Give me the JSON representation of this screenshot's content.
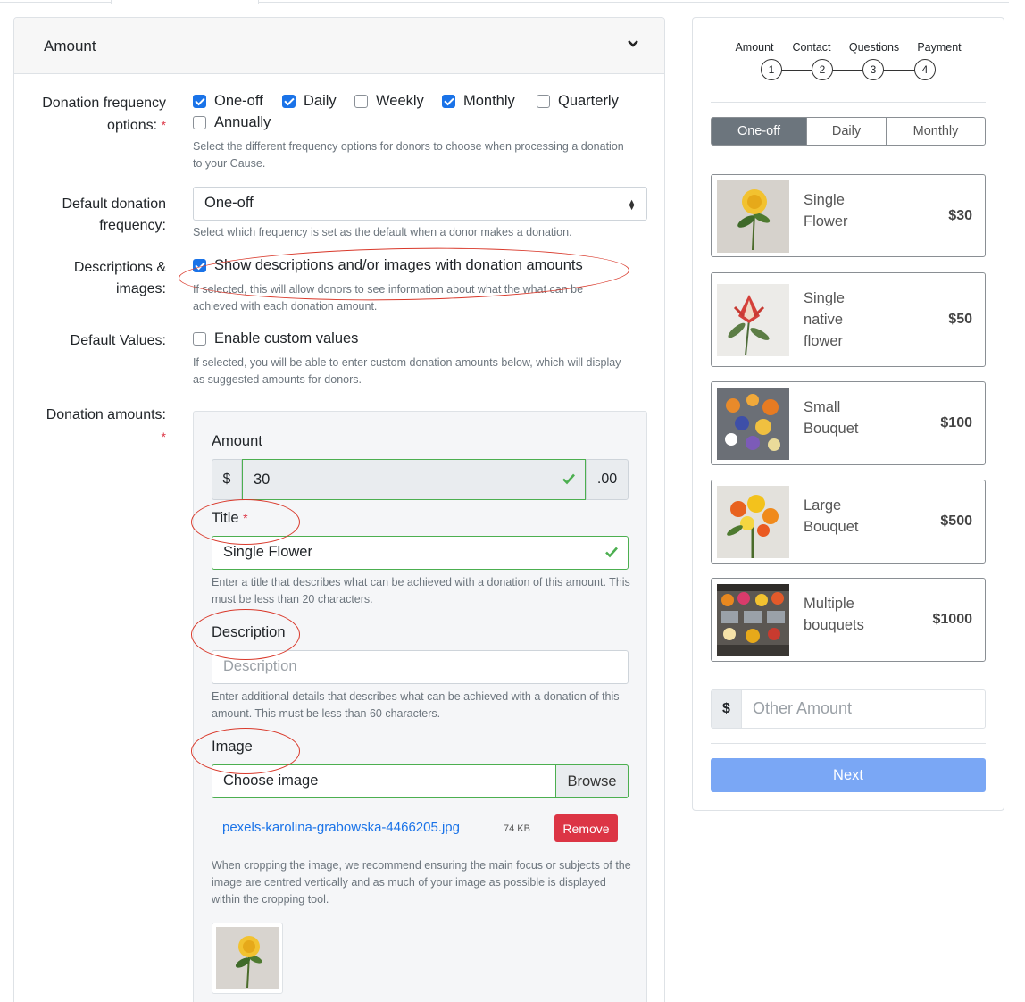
{
  "section": {
    "title": "Amount"
  },
  "form": {
    "frequency_label": "Donation frequency options:",
    "frequency_options": [
      {
        "label": "One-off",
        "checked": true
      },
      {
        "label": "Daily",
        "checked": true
      },
      {
        "label": "Weekly",
        "checked": false
      },
      {
        "label": "Monthly",
        "checked": true
      },
      {
        "label": "Quarterly",
        "checked": false
      },
      {
        "label": "Annually",
        "checked": false
      }
    ],
    "frequency_help": "Select the different frequency options for donors to choose when processing a donation to your Cause.",
    "default_frequency_label": "Default donation frequency:",
    "default_frequency_value": "One-off",
    "default_frequency_help": "Select which frequency is set as the default when a donor makes a donation.",
    "descriptions_label": "Descriptions & images:",
    "descriptions_checkbox": "Show descriptions and/or images with donation amounts",
    "descriptions_help": "If selected, this will allow donors to see information about what the what can be achieved with each donation amount.",
    "default_values_label": "Default Values:",
    "custom_values_checkbox": "Enable custom values",
    "custom_values_help": "If selected, you will be able to enter custom donation amounts below, which will display as suggested amounts for donors.",
    "donation_amounts_label": "Donation amounts:",
    "required_mark": "*"
  },
  "amount_panel": {
    "amount_label": "Amount",
    "currency_symbol": "$",
    "amount_value": "30",
    "cents": ".00",
    "title_label": "Title",
    "title_value": "Single Flower",
    "title_help": "Enter a title that describes what can be achieved with a donation of this amount. This must be less than 20 characters.",
    "description_label": "Description",
    "description_placeholder": "Description",
    "description_help": "Enter additional details that describes what can be achieved with a donation of this amount. This must be less than 60 characters.",
    "image_label": "Image",
    "image_placeholder": "Choose image",
    "browse_label": "Browse",
    "file_name": "pexels-karolina-grabowska-4466205.jpg",
    "file_size": "74 KB",
    "remove_label": "Remove",
    "crop_help": "When cropping the image, we recommend ensuring the main focus or subjects of the image are centred vertically and as much of your image as possible is displayed within the cropping tool."
  },
  "preview": {
    "steps": [
      {
        "label": "Amount",
        "number": "1"
      },
      {
        "label": "Contact",
        "number": "2"
      },
      {
        "label": "Questions",
        "number": "3"
      },
      {
        "label": "Payment",
        "number": "4"
      }
    ],
    "frequency_tabs": [
      {
        "label": "One-off",
        "active": true
      },
      {
        "label": "Daily",
        "active": false
      },
      {
        "label": "Monthly",
        "active": false
      }
    ],
    "options": [
      {
        "title_lines": [
          "Single",
          "Flower"
        ],
        "price": "$30",
        "icon": "yellow-flower-image"
      },
      {
        "title_lines": [
          "Single",
          "native",
          "flower"
        ],
        "price": "$50",
        "icon": "protea-flower-image"
      },
      {
        "title_lines": [
          "Small",
          "Bouquet"
        ],
        "price": "$100",
        "icon": "small-bouquet-image"
      },
      {
        "title_lines": [
          "Large",
          "Bouquet"
        ],
        "price": "$500",
        "icon": "large-bouquet-image"
      },
      {
        "title_lines": [
          "Multiple",
          "bouquets"
        ],
        "price": "$1000",
        "icon": "flower-stall-image"
      }
    ],
    "other_currency": "$",
    "other_placeholder": "Other Amount",
    "next_label": "Next"
  },
  "colors": {
    "accent": "#1a73e8",
    "valid": "#4caf50",
    "danger": "#dc3545",
    "annotation": "#d9392b",
    "next_button": "#7aa7f5"
  }
}
